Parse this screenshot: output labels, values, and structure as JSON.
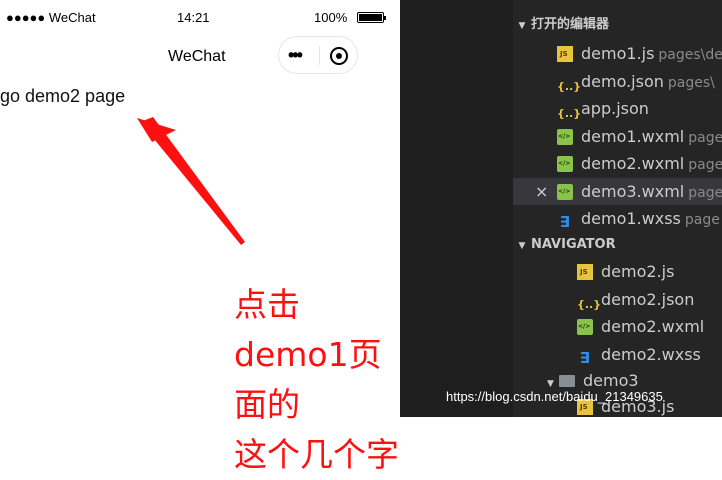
{
  "simulator": {
    "carrier": "●●●●● WeChat",
    "time": "14:21",
    "battery": "100%",
    "nav_title": "WeChat",
    "capsule_menu": "•••",
    "link_text": "go demo2 page"
  },
  "annotation": {
    "line1": "点击demo1页面的",
    "line2": "这个几个字",
    "color": "#ff1010"
  },
  "explorer": {
    "open_editors_title": "打开的编辑器",
    "open_editors": [
      {
        "name": "demo1.js",
        "path": "pages\\de",
        "type": "js",
        "selected": false
      },
      {
        "name": "demo.json",
        "path": "pages\\",
        "type": "json",
        "selected": false
      },
      {
        "name": "app.json",
        "path": "",
        "type": "json",
        "selected": false
      },
      {
        "name": "demo1.wxml",
        "path": "page",
        "type": "wxml",
        "selected": false
      },
      {
        "name": "demo2.wxml",
        "path": "page",
        "type": "wxml",
        "selected": false
      },
      {
        "name": "demo3.wxml",
        "path": "page",
        "type": "wxml",
        "selected": true,
        "close": "×"
      },
      {
        "name": "demo1.wxss",
        "path": "page",
        "type": "wxss",
        "selected": false
      }
    ],
    "navigator_title": "NAVIGATOR",
    "navigator": [
      {
        "name": "demo2.js",
        "type": "js"
      },
      {
        "name": "demo2.json",
        "type": "json"
      },
      {
        "name": "demo2.wxml",
        "type": "wxml"
      },
      {
        "name": "demo2.wxss",
        "type": "wxss"
      }
    ],
    "folder": "demo3",
    "folder_child": "demo3.js"
  },
  "watermark": "https://blog.csdn.net/baidu_21349635",
  "colors": {
    "editor_bg": "#1e1e1e",
    "sidebar_bg": "#252526",
    "selected_row": "#37373d"
  }
}
